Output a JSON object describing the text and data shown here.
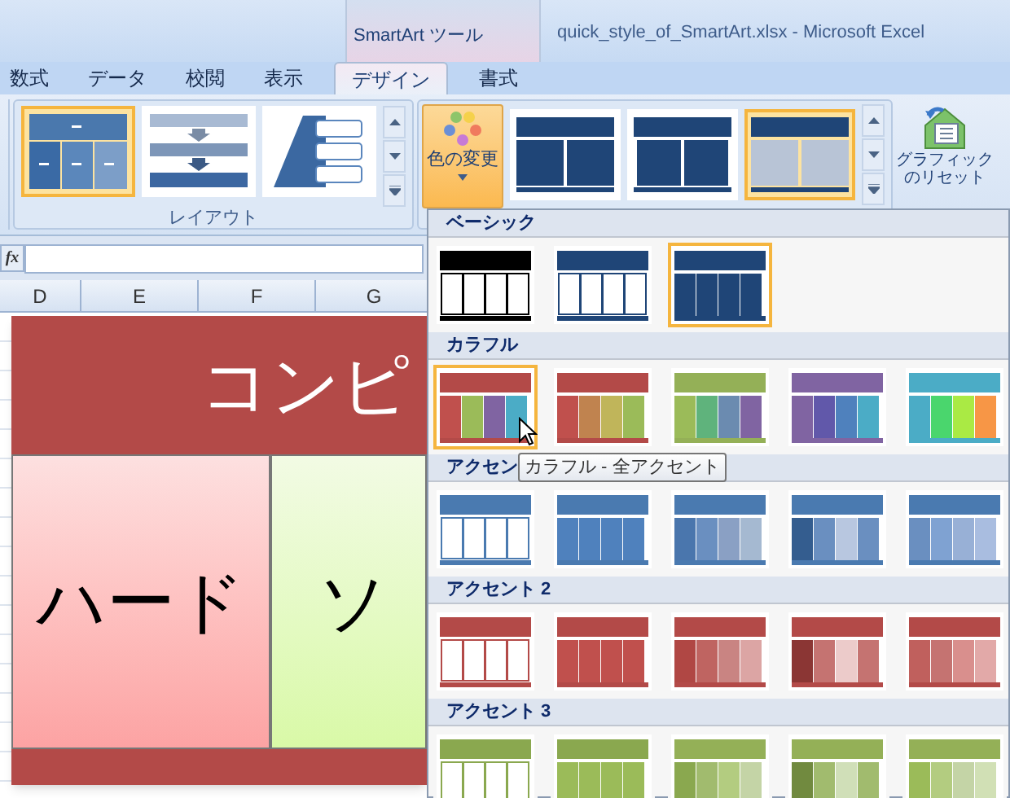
{
  "title_bar": {
    "context_tab": "SmartArt ツール",
    "title": "quick_style_of_SmartArt.xlsx - Microsoft Excel"
  },
  "tabs": [
    {
      "label": "数式",
      "selected": false
    },
    {
      "label": "データ",
      "selected": false
    },
    {
      "label": "校閲",
      "selected": false
    },
    {
      "label": "表示",
      "selected": false
    },
    {
      "label": "デザイン",
      "selected": true
    },
    {
      "label": "書式",
      "selected": false
    }
  ],
  "ribbon": {
    "layouts": {
      "label": "レイアウト",
      "items": [
        {
          "kind": "hierarchy",
          "selected": true
        },
        {
          "kind": "process",
          "selected": false
        },
        {
          "kind": "pyramid",
          "selected": false
        }
      ]
    },
    "change_colors_button": "色の変更",
    "styles": [
      {
        "kind": "flat",
        "selected": false
      },
      {
        "kind": "outline",
        "selected": false
      },
      {
        "kind": "gradient",
        "selected": true
      }
    ],
    "reset_button": "グラフィックのリセット"
  },
  "formula_bar": {
    "function_label": "fx"
  },
  "sheet": {
    "columns": [
      "D",
      "E",
      "F",
      "G"
    ],
    "smartart": {
      "title": "コンピ",
      "boxes": [
        {
          "label": "ハード",
          "kind": "pink"
        },
        {
          "label": "ソ",
          "kind": "green"
        }
      ]
    }
  },
  "color_menu": {
    "tooltip": "カラフル - 全アクセント",
    "sections": [
      {
        "title": "ベーシック",
        "items": [
          {
            "kind": "outline",
            "selected": false
          },
          {
            "kind": "outline",
            "selected": false
          },
          {
            "kind": "filled",
            "selected": true
          }
        ]
      },
      {
        "title": "カラフル",
        "items": [
          {
            "kind": "filled",
            "selected": true
          },
          {
            "kind": "filled",
            "selected": false
          },
          {
            "kind": "filled",
            "selected": false
          },
          {
            "kind": "filled",
            "selected": false
          },
          {
            "kind": "filled",
            "selected": false
          }
        ]
      },
      {
        "title": "アクセン",
        "items": [
          {
            "kind": "outline",
            "selected": false
          },
          {
            "kind": "filled",
            "selected": false
          },
          {
            "kind": "filled",
            "selected": false
          },
          {
            "kind": "filled",
            "selected": false
          },
          {
            "kind": "filled",
            "selected": false
          }
        ]
      },
      {
        "title": "アクセント 2",
        "items": [
          {
            "kind": "outline",
            "selected": false
          },
          {
            "kind": "filled",
            "selected": false
          },
          {
            "kind": "filled",
            "selected": false
          },
          {
            "kind": "filled",
            "selected": false
          },
          {
            "kind": "filled",
            "selected": false
          }
        ]
      },
      {
        "title": "アクセント 3",
        "items": [
          {
            "kind": "outline",
            "selected": false
          },
          {
            "kind": "filled",
            "selected": false
          },
          {
            "kind": "filled",
            "selected": false
          },
          {
            "kind": "filled",
            "selected": false
          },
          {
            "kind": "filled",
            "selected": false
          }
        ]
      }
    ]
  }
}
